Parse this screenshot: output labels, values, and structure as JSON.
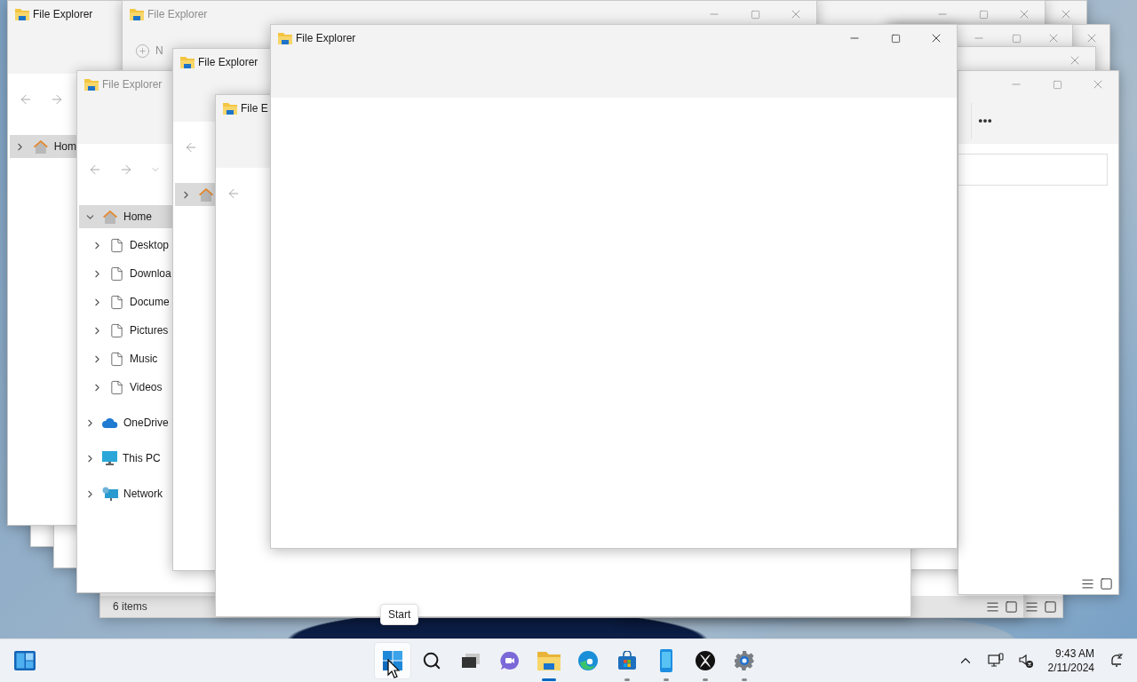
{
  "windows": [
    {
      "kind": "frame"
    },
    {
      "kind": "frame"
    },
    {
      "kind": "frame"
    },
    {
      "kind": "frame",
      "status": "6 items"
    },
    {
      "kind": "frame",
      "active": false
    },
    {
      "kind": "frame",
      "active": false
    },
    {
      "kind": "explorer",
      "title": "File Explorer",
      "active": true,
      "nav": [
        {
          "kind": "home",
          "label": "Hom",
          "expanded": false,
          "selected": true
        }
      ]
    },
    {
      "kind": "explorer",
      "title": "File Explorer",
      "active": false,
      "new_button": "N"
    },
    {
      "kind": "frame",
      "active": false
    },
    {
      "kind": "frame",
      "active": false
    },
    {
      "kind": "frame",
      "active": false
    },
    {
      "kind": "frame",
      "active": false
    },
    {
      "kind": "explorer",
      "title": "File Explorer",
      "active": false,
      "nav": [
        {
          "kind": "home",
          "label": "Home",
          "expanded": true,
          "selected": true,
          "children": [
            {
              "kind": "file",
              "label": "Desktop",
              "expanded": false,
              "selected": false
            },
            {
              "kind": "file",
              "label": "Downloa",
              "expanded": false,
              "selected": false
            },
            {
              "kind": "file",
              "label": "Docume",
              "expanded": false,
              "selected": false
            },
            {
              "kind": "file",
              "label": "Pictures",
              "expanded": false,
              "selected": false
            },
            {
              "kind": "file",
              "label": "Music",
              "expanded": false,
              "selected": false
            },
            {
              "kind": "file",
              "label": "Videos",
              "expanded": false,
              "selected": false
            }
          ]
        },
        {
          "kind": "cloud",
          "label": "OneDrive",
          "expanded": false,
          "selected": false
        },
        {
          "kind": "computer",
          "label": "This PC",
          "expanded": false,
          "selected": false
        },
        {
          "kind": "network",
          "label": "Network",
          "expanded": false,
          "selected": false
        }
      ]
    },
    {
      "kind": "explorer",
      "title": "File Explorer",
      "active": true,
      "nav": [
        {
          "kind": "home",
          "expanded": false,
          "selected": true
        }
      ]
    },
    {
      "kind": "explorer",
      "title": "File E",
      "active": true
    },
    {
      "kind": "explorer",
      "title": "File Explorer",
      "active": true
    }
  ],
  "tooltip": "Start",
  "taskbar": {
    "apps": [
      {
        "kind": "start",
        "hovered": true,
        "running": false,
        "selected": false
      },
      {
        "kind": "search",
        "hovered": false,
        "running": false,
        "selected": false
      },
      {
        "kind": "taskview",
        "hovered": false,
        "running": false,
        "selected": false
      },
      {
        "kind": "chat",
        "hovered": false,
        "running": false,
        "selected": false
      },
      {
        "kind": "explorer",
        "hovered": false,
        "running": true,
        "selected": true
      },
      {
        "kind": "edge",
        "hovered": false,
        "running": false,
        "selected": false
      },
      {
        "kind": "store",
        "hovered": false,
        "running": true,
        "selected": false
      },
      {
        "kind": "phone",
        "hovered": false,
        "running": true,
        "selected": false
      },
      {
        "kind": "xbox",
        "hovered": false,
        "running": true,
        "selected": false
      },
      {
        "kind": "settings",
        "hovered": false,
        "running": true,
        "selected": false
      }
    ],
    "clock": {
      "time": "9:43 AM",
      "date": "2/11/2024"
    }
  }
}
